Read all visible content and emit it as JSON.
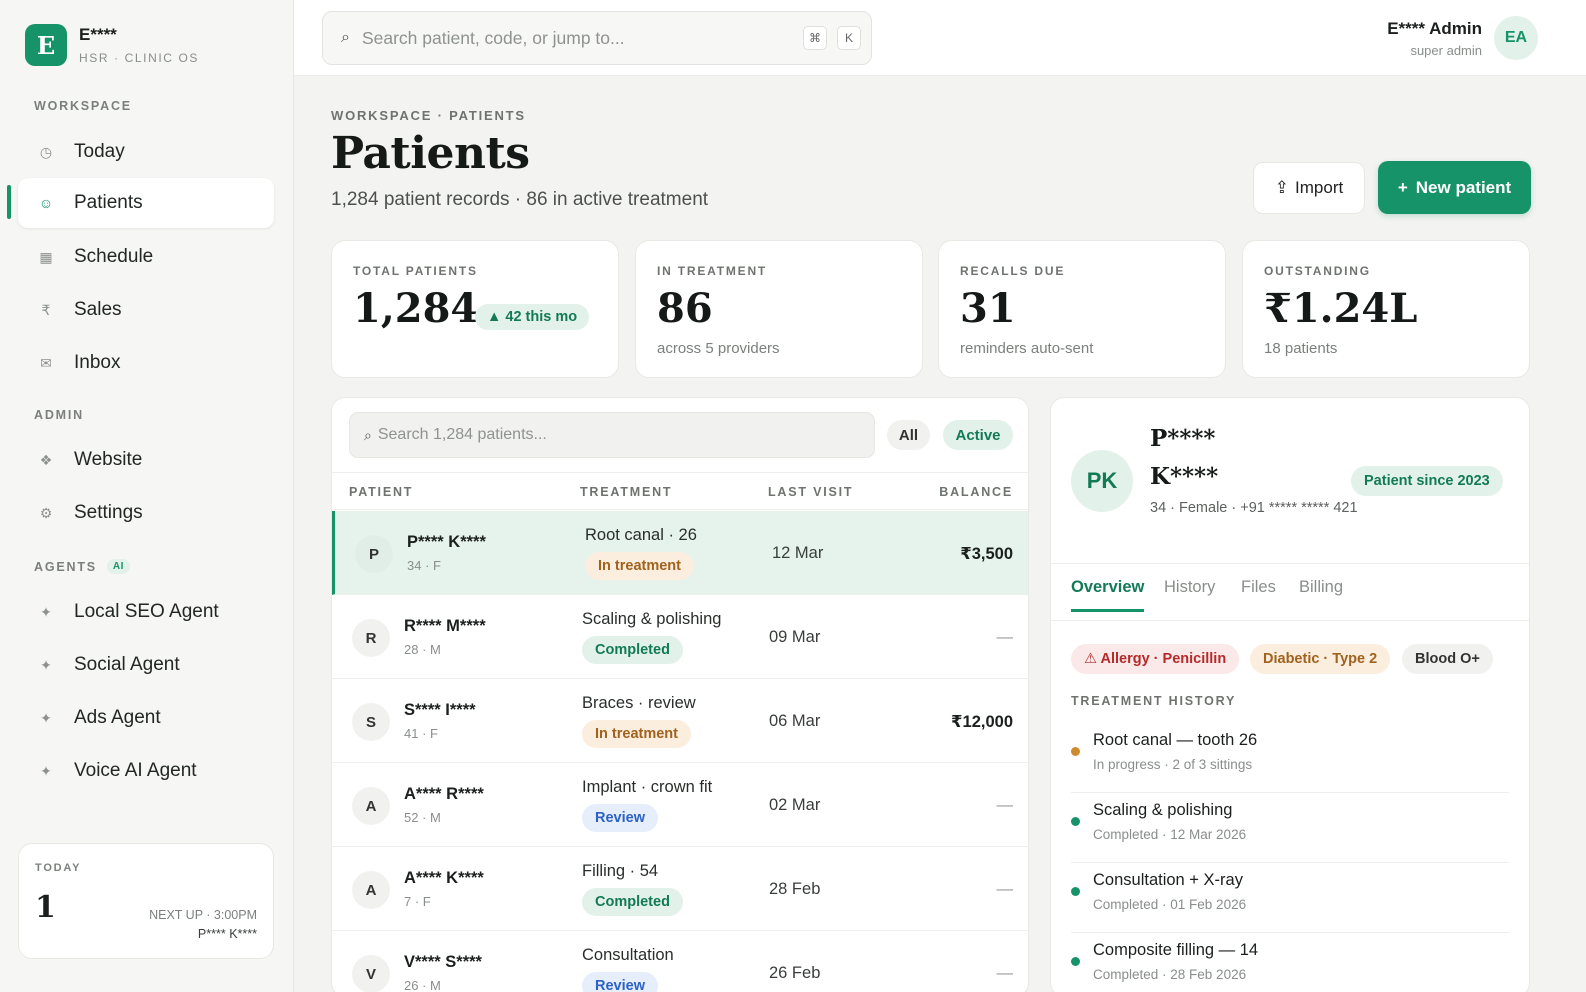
{
  "brand": {
    "logo_letter": "E",
    "name": "E****",
    "subtitle": "HSR · CLINIC OS"
  },
  "sidebar": {
    "workspace_label": "WORKSPACE",
    "workspace_items": [
      {
        "label": "Today",
        "icon": "clock-icon",
        "glyph": "◷"
      },
      {
        "label": "Patients",
        "icon": "smile-icon",
        "glyph": "☺"
      },
      {
        "label": "Schedule",
        "icon": "calendar-icon",
        "glyph": "▦"
      },
      {
        "label": "Sales",
        "icon": "rupee-icon",
        "glyph": "₹"
      },
      {
        "label": "Inbox",
        "icon": "mail-icon",
        "glyph": "✉"
      }
    ],
    "admin_label": "ADMIN",
    "admin_items": [
      {
        "label": "Website",
        "icon": "diamond-icon",
        "glyph": "❖"
      },
      {
        "label": "Settings",
        "icon": "gear-icon",
        "glyph": "⚙"
      }
    ],
    "agents_label": "AGENTS",
    "agents_badge": "AI",
    "agent_items": [
      {
        "label": "Local SEO Agent",
        "icon": "sparkle-icon",
        "glyph": "✦"
      },
      {
        "label": "Social Agent",
        "icon": "sparkle-icon",
        "glyph": "✦"
      },
      {
        "label": "Ads Agent",
        "icon": "sparkle-icon",
        "glyph": "✦"
      },
      {
        "label": "Voice AI Agent",
        "icon": "sparkle-icon",
        "glyph": "✦"
      }
    ],
    "today_card": {
      "label": "TODAY",
      "count": "1",
      "next_up": "NEXT UP · 3:00PM",
      "next_name": "P**** K****"
    }
  },
  "topbar": {
    "search_placeholder": "Search patient, code, or jump to...",
    "kbd_cmd": "⌘",
    "kbd_k": "K",
    "user_name": "E**** Admin",
    "user_role": "super admin",
    "user_initials": "EA"
  },
  "page": {
    "breadcrumb": "WORKSPACE · PATIENTS",
    "title": "Patients",
    "subtitle": "1,284 patient records · 86 in active treatment",
    "import_label": "Import",
    "new_label": "New patient"
  },
  "stats": [
    {
      "label": "TOTAL PATIENTS",
      "value": "1,284",
      "delta": "▲ 42 this mo",
      "sub": ""
    },
    {
      "label": "IN TREATMENT",
      "value": "86",
      "sub": "across 5 providers"
    },
    {
      "label": "RECALLS DUE",
      "value": "31",
      "sub": "reminders auto-sent"
    },
    {
      "label": "OUTSTANDING",
      "value": "₹1.24L",
      "sub": "18 patients"
    }
  ],
  "table": {
    "search_placeholder": "Search 1,284 patients...",
    "filter_all": "All",
    "filter_active": "Active",
    "headers": {
      "patient": "PATIENT",
      "treatment": "TREATMENT",
      "last_visit": "LAST VISIT",
      "balance": "BALANCE"
    },
    "rows": [
      {
        "initial": "P",
        "name": "P**** K****",
        "meta": "34 · F",
        "treatment": "Root canal · 26",
        "status": "In treatment",
        "status_kind": "inprog",
        "visit": "12 Mar",
        "balance": "₹3,500"
      },
      {
        "initial": "R",
        "name": "R**** M****",
        "meta": "28 · M",
        "treatment": "Scaling & polishing",
        "status": "Completed",
        "status_kind": "done",
        "visit": "09 Mar",
        "balance": "—"
      },
      {
        "initial": "S",
        "name": "S**** I****",
        "meta": "41 · F",
        "treatment": "Braces · review",
        "status": "In treatment",
        "status_kind": "inprog",
        "visit": "06 Mar",
        "balance": "₹12,000"
      },
      {
        "initial": "A",
        "name": "A**** R****",
        "meta": "52 · M",
        "treatment": "Implant · crown fit",
        "status": "Review",
        "status_kind": "review",
        "visit": "02 Mar",
        "balance": "—"
      },
      {
        "initial": "A",
        "name": "A**** K****",
        "meta": "7 · F",
        "treatment": "Filling · 54",
        "status": "Completed",
        "status_kind": "done",
        "visit": "28 Feb",
        "balance": "—"
      },
      {
        "initial": "V",
        "name": "V**** S****",
        "meta": "26 · M",
        "treatment": "Consultation",
        "status": "Review",
        "status_kind": "review",
        "visit": "26 Feb",
        "balance": "—"
      }
    ]
  },
  "detail": {
    "initials": "PK",
    "name": "P**** K****",
    "meta": "34 · Female · +91 ***** ***** 421",
    "since": "Patient since 2023",
    "tabs": [
      "Overview",
      "History",
      "Files",
      "Billing"
    ],
    "chips": {
      "allergy": "⚠ Allergy · Penicillin",
      "diabetic": "Diabetic · Type 2",
      "blood": "Blood O+"
    },
    "section_label": "TREATMENT HISTORY",
    "history": [
      {
        "title": "Root canal — tooth 26",
        "sub": "In progress · 2 of 3 sittings",
        "color": "#d08a2e"
      },
      {
        "title": "Scaling & polishing",
        "sub": "Completed · 12 Mar 2026",
        "color": "#17936a"
      },
      {
        "title": "Consultation + X-ray",
        "sub": "Completed · 01 Feb 2026",
        "color": "#17936a"
      },
      {
        "title": "Composite filling — 14",
        "sub": "Completed · 28 Feb 2026",
        "color": "#17936a"
      }
    ]
  },
  "colors": {
    "accent": "#17936a",
    "accent_soft": "#e2f1ea",
    "warning": "#a0621d",
    "danger": "#b52a2a",
    "info": "#2b62c4"
  }
}
